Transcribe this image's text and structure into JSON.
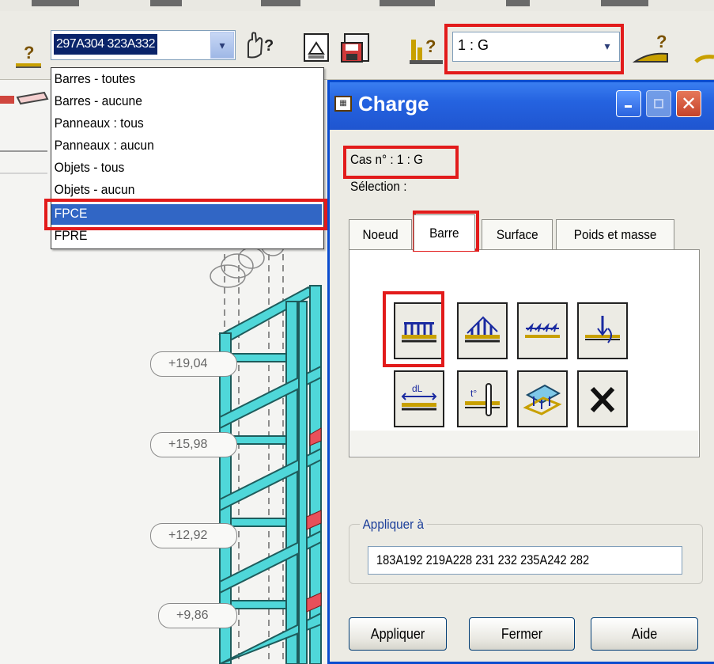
{
  "toolbar": {
    "selection_value": "297A304 323A332",
    "case_value": "1 : G",
    "icons": [
      "selection-help-icon",
      "selection-filter-icon",
      "view-icon",
      "save-view-icon",
      "load-case-help-icon",
      "load-help-icon"
    ]
  },
  "dropdown": {
    "items": [
      "Barres - toutes",
      "Barres - aucune",
      "Panneaux : tous",
      "Panneaux : aucun",
      "Objets - tous",
      "Objets - aucun",
      "FPCE",
      "FPRE"
    ],
    "selected_index": 6
  },
  "canvas": {
    "levels": [
      "+19,04",
      "+15,98",
      "+12,92",
      "+9,86"
    ]
  },
  "dialog": {
    "title": "Charge",
    "case_label": "Cas n° : 1 : G",
    "selection_label": "Sélection :",
    "tabs": [
      "Noeud",
      "Barre",
      "Surface",
      "Poids et masse"
    ],
    "active_tab": "Barre",
    "load_buttons": [
      {
        "name": "uniform-load-icon"
      },
      {
        "name": "trapezoidal-load-icon"
      },
      {
        "name": "moment-load-icon"
      },
      {
        "name": "concentrated-load-icon"
      },
      {
        "name": "dilatation-load-icon"
      },
      {
        "name": "thermal-load-icon"
      },
      {
        "name": "surface-on-bar-load-icon"
      },
      {
        "name": "delete-load-icon"
      }
    ],
    "apply_to_label": "Appliquer à",
    "apply_to_value": "183A192 219A228 231 232 235A242 282",
    "buttons": {
      "apply": "Appliquer",
      "close": "Fermer",
      "help": "Aide"
    }
  },
  "colors": {
    "structure": "#4fd7d9",
    "structure_edge": "#1e5c5c",
    "highlight_red": "#e21b1b",
    "title_blue": "#2563e0",
    "selection_blue": "#3166c5"
  }
}
